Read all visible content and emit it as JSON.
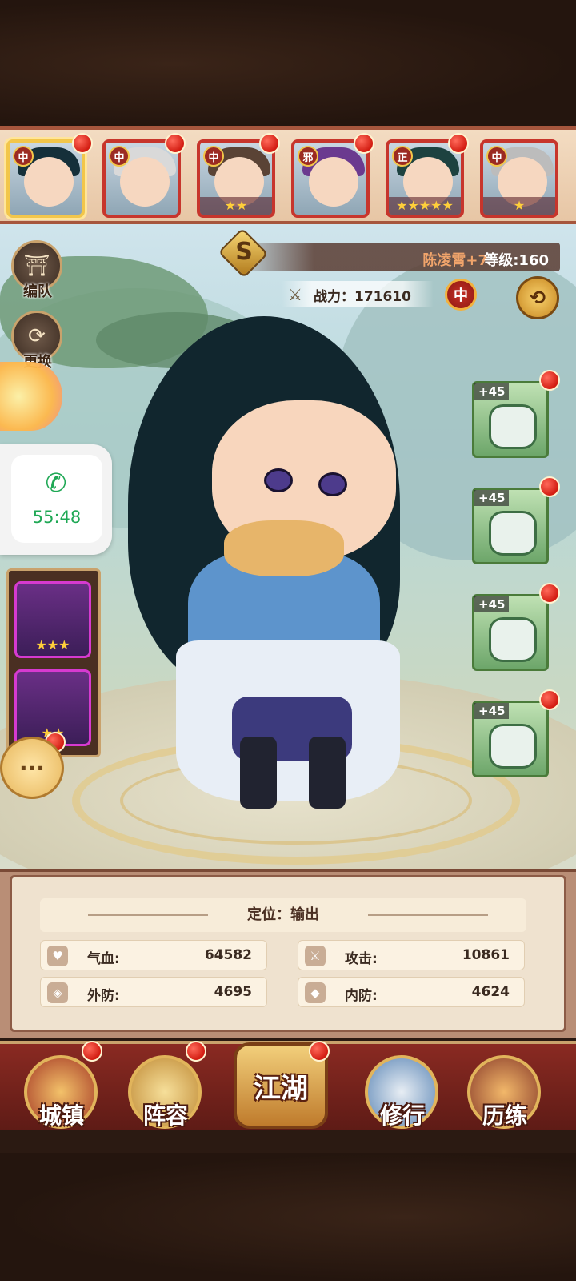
{
  "roster": {
    "heroes": [
      {
        "tag": "中",
        "stars": "",
        "selected": true
      },
      {
        "tag": "中",
        "stars": ""
      },
      {
        "tag": "中",
        "stars": "★★"
      },
      {
        "tag": "邪",
        "stars": ""
      },
      {
        "tag": "正",
        "stars": "★★★★★"
      },
      {
        "tag": "中",
        "stars": "★"
      }
    ]
  },
  "hero": {
    "grade": "S",
    "name": "陈凌霄+7",
    "level_label": "等级:160",
    "power_label": "战力：171610",
    "faction": "中"
  },
  "left_buttons": {
    "formation": "编队",
    "swap": "更换"
  },
  "call": {
    "time": "55:48"
  },
  "gear_left": [
    {
      "stars": "★★★"
    },
    {
      "stars": "★★"
    }
  ],
  "equipment": [
    {
      "plus": "+45"
    },
    {
      "plus": "+45"
    },
    {
      "plus": "+45"
    },
    {
      "plus": "+45"
    }
  ],
  "stats": {
    "role": "定位：输出",
    "hp_label": "气血:",
    "hp_value": "64582",
    "atk_label": "攻击:",
    "atk_value": "10861",
    "def_out_label": "外防:",
    "def_out_value": "4695",
    "def_in_label": "内防:",
    "def_in_value": "4624"
  },
  "nav": {
    "town": "城镇",
    "lineup": "阵容",
    "jianghu": "江湖",
    "cultivate": "修行",
    "trial": "历练"
  },
  "colors": {
    "alert_red": "#d31d12",
    "gold": "#f2c64a",
    "frame_brown": "#2b1a12"
  }
}
